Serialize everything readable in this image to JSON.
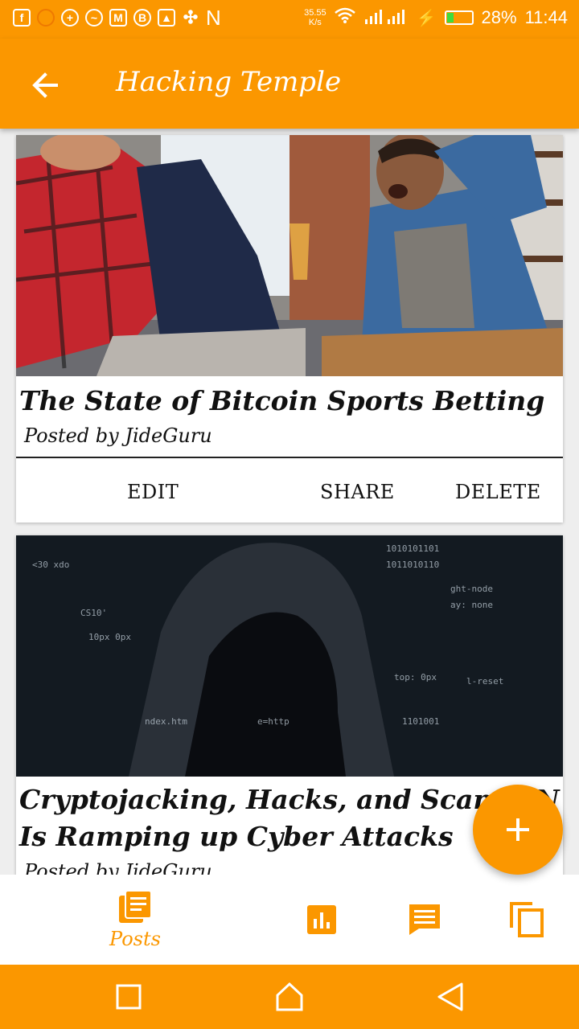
{
  "status_bar": {
    "left_icons": [
      "facebook-icon",
      "notification-dot-icon",
      "messenger-plus-icon",
      "messenger-icon",
      "gmail-icon",
      "b-icon",
      "image-icon",
      "pinwheel-icon",
      "n-icon"
    ],
    "n_letter": "N",
    "speed_value": "35.55",
    "speed_unit": "K/s",
    "battery_percent": "28%",
    "battery_level": 0.28,
    "time": "11:44"
  },
  "app_bar": {
    "title": "Hacking Temple",
    "back_icon": "arrow-back-icon"
  },
  "posts": [
    {
      "title": "The State of Bitcoin Sports Betting",
      "author": "Posted by JideGuru",
      "actions": {
        "edit": "EDIT",
        "share": "SHARE",
        "delete": "DELETE"
      }
    },
    {
      "title": " Cryptojacking, Hacks, and Scams: N... Is Ramping up Cyber Attacks",
      "title_line1": " Cryptojacking, Hacks, and Scams: N",
      "title_line2": "Is Ramping up Cyber Attacks",
      "author": "Posted by JideGuru"
    }
  ],
  "fab": {
    "icon": "plus-icon"
  },
  "bottom_nav": {
    "items": [
      {
        "label": "Posts",
        "icon": "posts-icon",
        "active": true
      },
      {
        "label": "",
        "icon": "bar-chart-icon",
        "active": false
      },
      {
        "label": "",
        "icon": "comment-icon",
        "active": false
      },
      {
        "label": "",
        "icon": "copy-icon",
        "active": false
      }
    ]
  },
  "colors": {
    "primary": "#fb9700",
    "text": "#111111",
    "background": "#eeeeee"
  }
}
